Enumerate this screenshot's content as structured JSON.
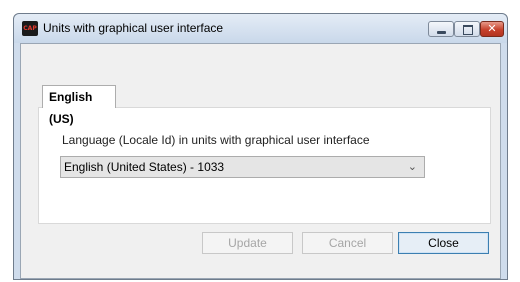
{
  "window": {
    "title": "Units with graphical user interface",
    "app_icon_text": "CAP"
  },
  "title_buttons": {
    "minimize": "minimize-icon",
    "maximize": "maximize-icon",
    "close": "close-icon",
    "close_glyph": "✕"
  },
  "tabs": [
    {
      "label": "English (US)",
      "selected": true
    }
  ],
  "panel": {
    "label": "Language (Locale Id) in units with graphical user interface",
    "select_value": "English (United States) - 1033"
  },
  "buttons": {
    "update": "Update",
    "cancel": "Cancel",
    "close": "Close"
  },
  "colors": {
    "titlebar": "#cfdcec",
    "close_button": "#c7412c",
    "focus_border": "#3c7fb1"
  }
}
